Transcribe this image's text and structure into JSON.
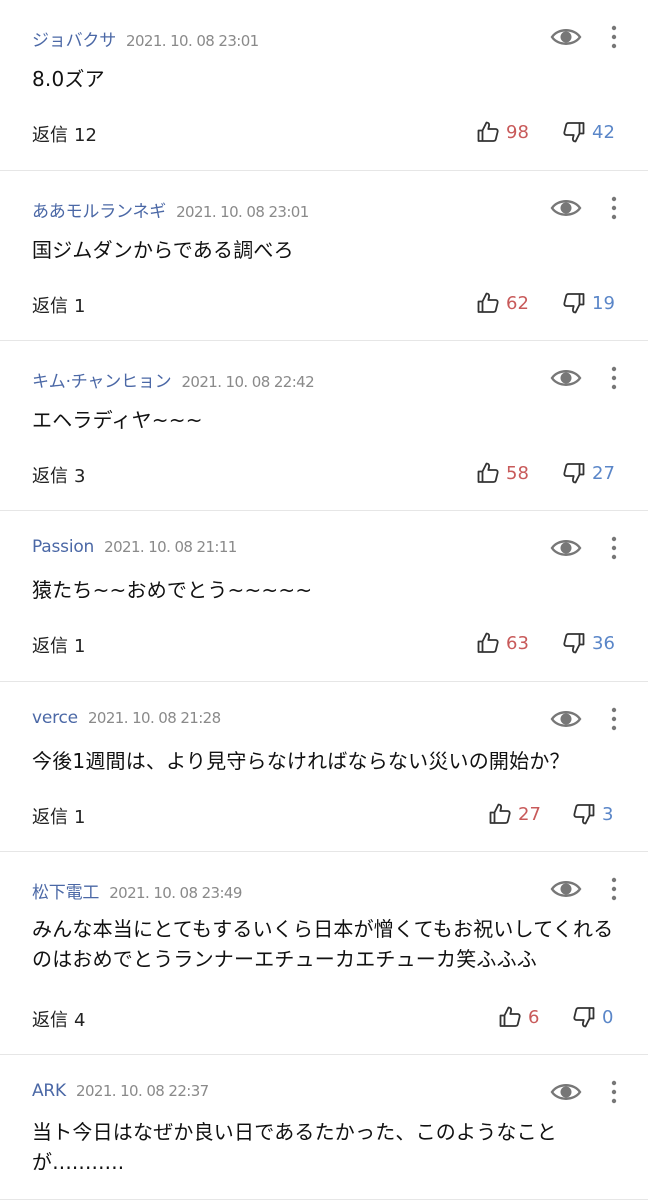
{
  "comments": [
    {
      "author": "ジョバクサ",
      "date": "2021. 10. 08 23:01",
      "text": "8.0ズア",
      "reply_label": "返信",
      "reply_count": "12",
      "likes": "98",
      "dislikes": "42"
    },
    {
      "author": "ああモルランネギ",
      "date": "2021. 10. 08 23:01",
      "text": "国ジムダンからである調べろ",
      "reply_label": "返信",
      "reply_count": "1",
      "likes": "62",
      "dislikes": "19"
    },
    {
      "author": "キム·チャンヒョン",
      "date": "2021. 10. 08 22:42",
      "text": "エヘラディヤ~~~",
      "reply_label": "返信",
      "reply_count": "3",
      "likes": "58",
      "dislikes": "27"
    },
    {
      "author": "Passion",
      "date": "2021. 10. 08 21:11",
      "text": "猿たち~~おめでとう~~~~~",
      "reply_label": "返信",
      "reply_count": "1",
      "likes": "63",
      "dislikes": "36"
    },
    {
      "author": "verce",
      "date": "2021. 10. 08 21:28",
      "text": "今後1週間は、より見守らなければならない災いの開始か？",
      "reply_label": "返信",
      "reply_count": "1",
      "likes": "27",
      "dislikes": "3"
    },
    {
      "author": "松下電工",
      "date": "2021. 10. 08 23:49",
      "text": "みんな本当にとてもするいくら日本が憎くてもお祝いしてくれるのはおめでとうランナーエチューカエチューカ笑ふふふ",
      "reply_label": "返信",
      "reply_count": "4",
      "likes": "6",
      "dislikes": "0"
    },
    {
      "author": "ARK",
      "date": "2021. 10. 08 22:37",
      "text": "当ト今日はなぜか良い日であるたかった、このようなことが..........."
    }
  ],
  "icons": {
    "view": "eye-icon",
    "more": "more-vertical-icon",
    "like": "thumbs-up-icon",
    "dislike": "thumbs-down-icon"
  },
  "colors": {
    "author": "#4b68a6",
    "date": "#8a8a8a",
    "likes": "#c85a5a",
    "dislikes": "#5a86c8",
    "divider": "#e6e6e6"
  }
}
